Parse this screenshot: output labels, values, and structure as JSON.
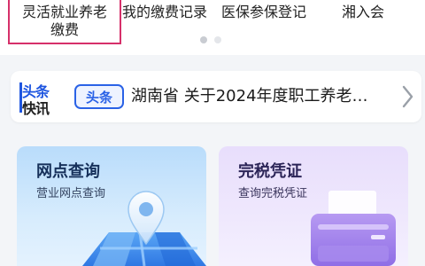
{
  "services": [
    {
      "line1": "灵活就业养老",
      "line2": "缴费"
    },
    {
      "line1": "我的缴费记录",
      "line2": ""
    },
    {
      "line1": "医保参保登记",
      "line2": ""
    },
    {
      "line1": "湘入会",
      "line2": ""
    }
  ],
  "pager": {
    "total": 2,
    "active": 1
  },
  "news": {
    "logo_line1": "头条",
    "logo_line2": "快讯",
    "tag": "头条",
    "headline": "湖南省 关于2024年度职工养老…"
  },
  "cards": [
    {
      "title": "网点查询",
      "subtitle": "营业网点查询",
      "icon": "map-pin-icon"
    },
    {
      "title": "完税凭证",
      "subtitle": "查询完税凭证",
      "icon": "printer-icon"
    }
  ],
  "colors": {
    "highlight_border": "#d6306a",
    "brand_blue": "#2a62e6",
    "card_blue": "#b9dcfb",
    "card_purple": "#e8defc"
  }
}
